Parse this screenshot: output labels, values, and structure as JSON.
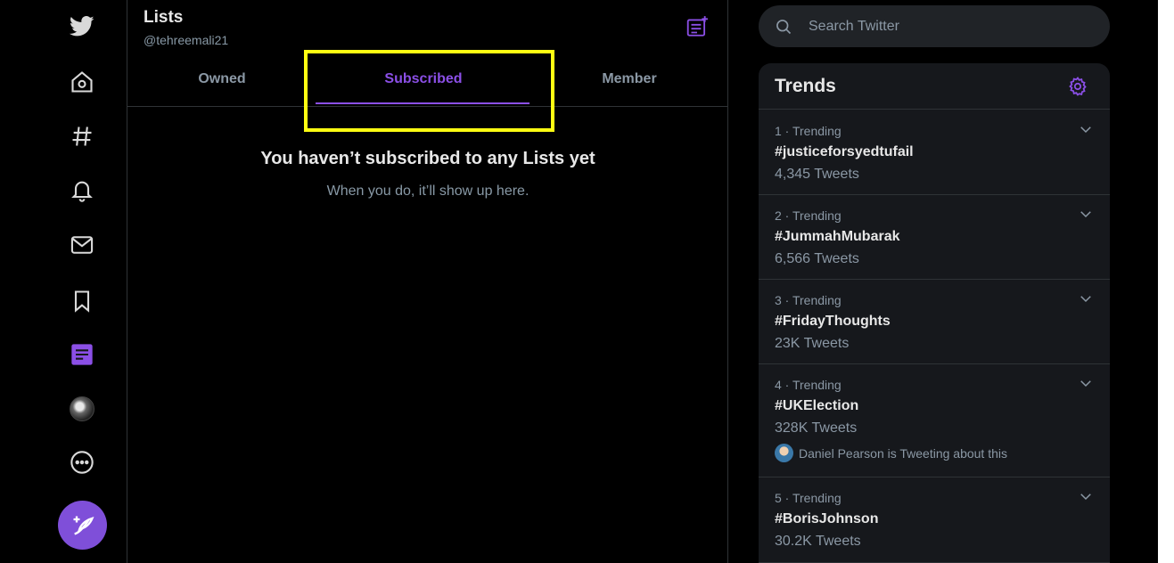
{
  "nav": {
    "items": [
      {
        "name": "twitter-logo",
        "icon": "bird-icon"
      },
      {
        "name": "home",
        "icon": "home-icon"
      },
      {
        "name": "explore",
        "icon": "hashtag-icon"
      },
      {
        "name": "notifications",
        "icon": "bell-icon"
      },
      {
        "name": "messages",
        "icon": "envelope-icon"
      },
      {
        "name": "bookmarks",
        "icon": "bookmark-icon"
      },
      {
        "name": "lists",
        "icon": "list-icon"
      },
      {
        "name": "profile",
        "icon": "avatar"
      },
      {
        "name": "more",
        "icon": "more-icon"
      }
    ],
    "tweet_icon": "compose-tweet-icon"
  },
  "header": {
    "title": "Lists",
    "handle": "@tehreemali21",
    "new_list_icon": "new-list-icon"
  },
  "tabs": [
    {
      "label": "Owned",
      "active": false
    },
    {
      "label": "Subscribed",
      "active": true
    },
    {
      "label": "Member",
      "active": false
    }
  ],
  "empty_state": {
    "title": "You haven’t subscribed to any Lists yet",
    "subtitle": "When you do, it’ll show up here."
  },
  "search": {
    "placeholder": "Search Twitter"
  },
  "trends": {
    "title": "Trends",
    "items": [
      {
        "meta": "1 · Trending",
        "name": "#justiceforsyedtufail",
        "count": "4,345 Tweets"
      },
      {
        "meta": "2 · Trending",
        "name": "#JummahMubarak",
        "count": "6,566 Tweets"
      },
      {
        "meta": "3 · Trending",
        "name": "#FridayThoughts",
        "count": "23K Tweets"
      },
      {
        "meta": "4 · Trending",
        "name": "#UKElection",
        "count": "328K Tweets",
        "context": "Daniel Pearson is Tweeting about this"
      },
      {
        "meta": "5 · Trending",
        "name": "#BorisJohnson",
        "count": "30.2K Tweets"
      }
    ]
  },
  "colors": {
    "accent": "#8b4fe6",
    "highlight": "#ffff12",
    "background": "#000000",
    "panel": "#16181c"
  }
}
